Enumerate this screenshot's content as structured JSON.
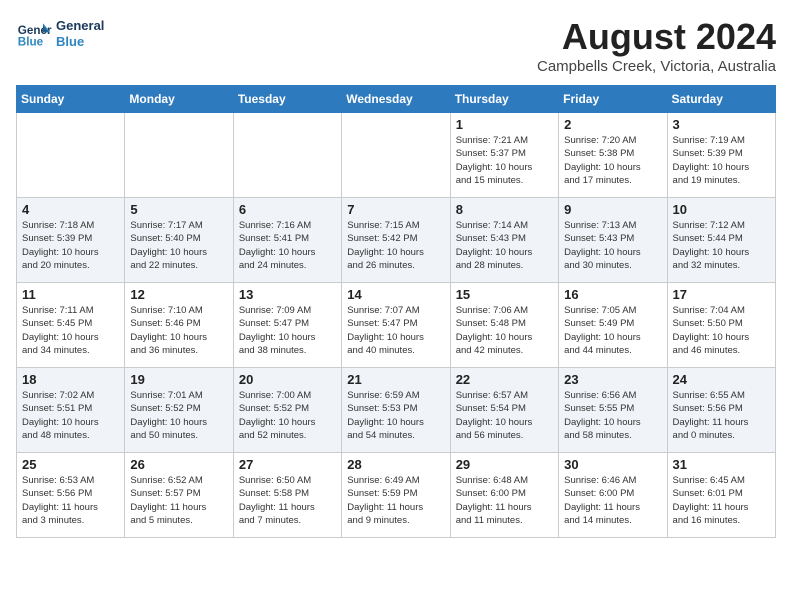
{
  "logo": {
    "line1": "General",
    "line2": "Blue"
  },
  "title": "August 2024",
  "location": "Campbells Creek, Victoria, Australia",
  "weekdays": [
    "Sunday",
    "Monday",
    "Tuesday",
    "Wednesday",
    "Thursday",
    "Friday",
    "Saturday"
  ],
  "weeks": [
    [
      {
        "day": "",
        "info": ""
      },
      {
        "day": "",
        "info": ""
      },
      {
        "day": "",
        "info": ""
      },
      {
        "day": "",
        "info": ""
      },
      {
        "day": "1",
        "info": "Sunrise: 7:21 AM\nSunset: 5:37 PM\nDaylight: 10 hours\nand 15 minutes."
      },
      {
        "day": "2",
        "info": "Sunrise: 7:20 AM\nSunset: 5:38 PM\nDaylight: 10 hours\nand 17 minutes."
      },
      {
        "day": "3",
        "info": "Sunrise: 7:19 AM\nSunset: 5:39 PM\nDaylight: 10 hours\nand 19 minutes."
      }
    ],
    [
      {
        "day": "4",
        "info": "Sunrise: 7:18 AM\nSunset: 5:39 PM\nDaylight: 10 hours\nand 20 minutes."
      },
      {
        "day": "5",
        "info": "Sunrise: 7:17 AM\nSunset: 5:40 PM\nDaylight: 10 hours\nand 22 minutes."
      },
      {
        "day": "6",
        "info": "Sunrise: 7:16 AM\nSunset: 5:41 PM\nDaylight: 10 hours\nand 24 minutes."
      },
      {
        "day": "7",
        "info": "Sunrise: 7:15 AM\nSunset: 5:42 PM\nDaylight: 10 hours\nand 26 minutes."
      },
      {
        "day": "8",
        "info": "Sunrise: 7:14 AM\nSunset: 5:43 PM\nDaylight: 10 hours\nand 28 minutes."
      },
      {
        "day": "9",
        "info": "Sunrise: 7:13 AM\nSunset: 5:43 PM\nDaylight: 10 hours\nand 30 minutes."
      },
      {
        "day": "10",
        "info": "Sunrise: 7:12 AM\nSunset: 5:44 PM\nDaylight: 10 hours\nand 32 minutes."
      }
    ],
    [
      {
        "day": "11",
        "info": "Sunrise: 7:11 AM\nSunset: 5:45 PM\nDaylight: 10 hours\nand 34 minutes."
      },
      {
        "day": "12",
        "info": "Sunrise: 7:10 AM\nSunset: 5:46 PM\nDaylight: 10 hours\nand 36 minutes."
      },
      {
        "day": "13",
        "info": "Sunrise: 7:09 AM\nSunset: 5:47 PM\nDaylight: 10 hours\nand 38 minutes."
      },
      {
        "day": "14",
        "info": "Sunrise: 7:07 AM\nSunset: 5:47 PM\nDaylight: 10 hours\nand 40 minutes."
      },
      {
        "day": "15",
        "info": "Sunrise: 7:06 AM\nSunset: 5:48 PM\nDaylight: 10 hours\nand 42 minutes."
      },
      {
        "day": "16",
        "info": "Sunrise: 7:05 AM\nSunset: 5:49 PM\nDaylight: 10 hours\nand 44 minutes."
      },
      {
        "day": "17",
        "info": "Sunrise: 7:04 AM\nSunset: 5:50 PM\nDaylight: 10 hours\nand 46 minutes."
      }
    ],
    [
      {
        "day": "18",
        "info": "Sunrise: 7:02 AM\nSunset: 5:51 PM\nDaylight: 10 hours\nand 48 minutes."
      },
      {
        "day": "19",
        "info": "Sunrise: 7:01 AM\nSunset: 5:52 PM\nDaylight: 10 hours\nand 50 minutes."
      },
      {
        "day": "20",
        "info": "Sunrise: 7:00 AM\nSunset: 5:52 PM\nDaylight: 10 hours\nand 52 minutes."
      },
      {
        "day": "21",
        "info": "Sunrise: 6:59 AM\nSunset: 5:53 PM\nDaylight: 10 hours\nand 54 minutes."
      },
      {
        "day": "22",
        "info": "Sunrise: 6:57 AM\nSunset: 5:54 PM\nDaylight: 10 hours\nand 56 minutes."
      },
      {
        "day": "23",
        "info": "Sunrise: 6:56 AM\nSunset: 5:55 PM\nDaylight: 10 hours\nand 58 minutes."
      },
      {
        "day": "24",
        "info": "Sunrise: 6:55 AM\nSunset: 5:56 PM\nDaylight: 11 hours\nand 0 minutes."
      }
    ],
    [
      {
        "day": "25",
        "info": "Sunrise: 6:53 AM\nSunset: 5:56 PM\nDaylight: 11 hours\nand 3 minutes."
      },
      {
        "day": "26",
        "info": "Sunrise: 6:52 AM\nSunset: 5:57 PM\nDaylight: 11 hours\nand 5 minutes."
      },
      {
        "day": "27",
        "info": "Sunrise: 6:50 AM\nSunset: 5:58 PM\nDaylight: 11 hours\nand 7 minutes."
      },
      {
        "day": "28",
        "info": "Sunrise: 6:49 AM\nSunset: 5:59 PM\nDaylight: 11 hours\nand 9 minutes."
      },
      {
        "day": "29",
        "info": "Sunrise: 6:48 AM\nSunset: 6:00 PM\nDaylight: 11 hours\nand 11 minutes."
      },
      {
        "day": "30",
        "info": "Sunrise: 6:46 AM\nSunset: 6:00 PM\nDaylight: 11 hours\nand 14 minutes."
      },
      {
        "day": "31",
        "info": "Sunrise: 6:45 AM\nSunset: 6:01 PM\nDaylight: 11 hours\nand 16 minutes."
      }
    ]
  ]
}
